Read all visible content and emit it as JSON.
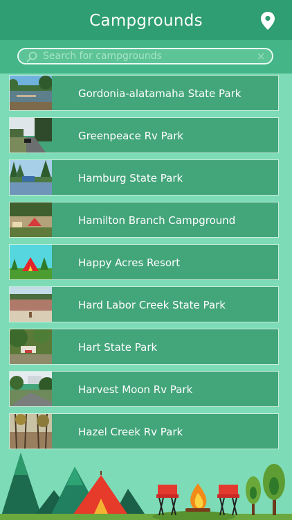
{
  "header": {
    "title": "Campgrounds",
    "location_icon": "map-marker-icon"
  },
  "search": {
    "placeholder": "Search for campgrounds",
    "value": "",
    "search_icon": "magnifier-icon",
    "clear_icon": "clear-x-icon",
    "clear_glyph": "×"
  },
  "campgrounds": [
    {
      "name": "Gordonia-alatamaha State Park"
    },
    {
      "name": "Greenpeace Rv Park"
    },
    {
      "name": "Hamburg State Park"
    },
    {
      "name": "Hamilton Branch Campground"
    },
    {
      "name": "Happy Acres Resort"
    },
    {
      "name": "Hard Labor Creek State Park"
    },
    {
      "name": "Hart State Park"
    },
    {
      "name": "Harvest Moon Rv Park"
    },
    {
      "name": "Hazel Creek Rv Park"
    }
  ],
  "colors": {
    "header_bg": "#2f9e72",
    "search_bar_bg": "#43b586",
    "list_item_bg": "#43a57a",
    "page_bg": "#7ddcb7"
  }
}
